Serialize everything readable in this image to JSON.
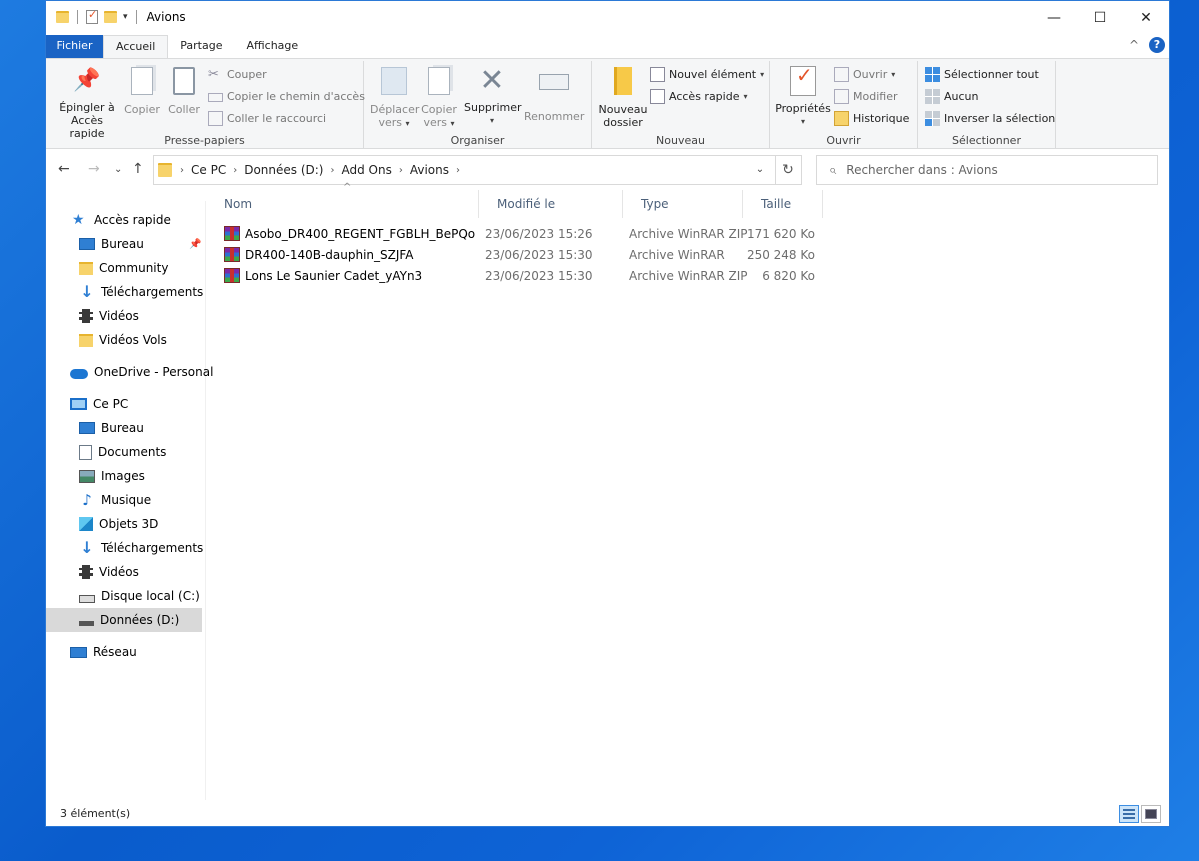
{
  "window": {
    "title": "Avions"
  },
  "title_buttons": {
    "minimize": "—",
    "maximize": "☐",
    "close": "✕"
  },
  "tabs": [
    {
      "label": "Fichier"
    },
    {
      "label": "Accueil"
    },
    {
      "label": "Partage"
    },
    {
      "label": "Affichage"
    }
  ],
  "ribbon": {
    "clipboard": {
      "group": "Presse-papiers",
      "pin_line1": "Épingler à",
      "pin_line2": "Accès rapide",
      "copy": "Copier",
      "paste": "Coller",
      "cut": "Couper",
      "copy_path": "Copier le chemin d'accès",
      "paste_shortcut": "Coller le raccourci"
    },
    "organize": {
      "group": "Organiser",
      "move_line1": "Déplacer",
      "move_line2": "vers",
      "copyto_line1": "Copier",
      "copyto_line2": "vers",
      "delete": "Supprimer",
      "rename": "Renommer"
    },
    "new": {
      "group": "Nouveau",
      "folder_line1": "Nouveau",
      "folder_line2": "dossier",
      "new_item": "Nouvel élément",
      "easy_access": "Accès rapide"
    },
    "open": {
      "group": "Ouvrir",
      "properties": "Propriétés",
      "open": "Ouvrir",
      "edit": "Modifier",
      "history": "Historique"
    },
    "select": {
      "group": "Sélectionner",
      "select_all": "Sélectionner tout",
      "select_none": "Aucun",
      "invert": "Inverser la sélection"
    }
  },
  "address": {
    "crumbs": [
      "Ce PC",
      "Données (D:)",
      "Add Ons",
      "Avions"
    ]
  },
  "search": {
    "placeholder": "Rechercher dans : Avions"
  },
  "nav": {
    "quick_access": "Accès rapide",
    "quick_items": [
      "Bureau",
      "Community",
      "Téléchargements",
      "Vidéos",
      "Vidéos Vols"
    ],
    "onedrive": "OneDrive - Personal",
    "this_pc": "Ce PC",
    "pc_items": [
      "Bureau",
      "Documents",
      "Images",
      "Musique",
      "Objets 3D",
      "Téléchargements",
      "Vidéos",
      "Disque local (C:)",
      "Données (D:)"
    ],
    "network": "Réseau"
  },
  "columns": {
    "name": "Nom",
    "modified": "Modifié le",
    "type": "Type",
    "size": "Taille"
  },
  "files": [
    {
      "name": "Asobo_DR400_REGENT_FGBLH_BePQo",
      "modified": "23/06/2023 15:26",
      "type": "Archive WinRAR ZIP",
      "size": "171 620 Ko"
    },
    {
      "name": "DR400-140B-dauphin_SZJFA",
      "modified": "23/06/2023 15:30",
      "type": "Archive WinRAR",
      "size": "250 248 Ko"
    },
    {
      "name": "Lons Le Saunier Cadet_yAYn3",
      "modified": "23/06/2023 15:30",
      "type": "Archive WinRAR ZIP",
      "size": "6 820 Ko"
    }
  ],
  "status": {
    "count": "3 élément(s)"
  }
}
